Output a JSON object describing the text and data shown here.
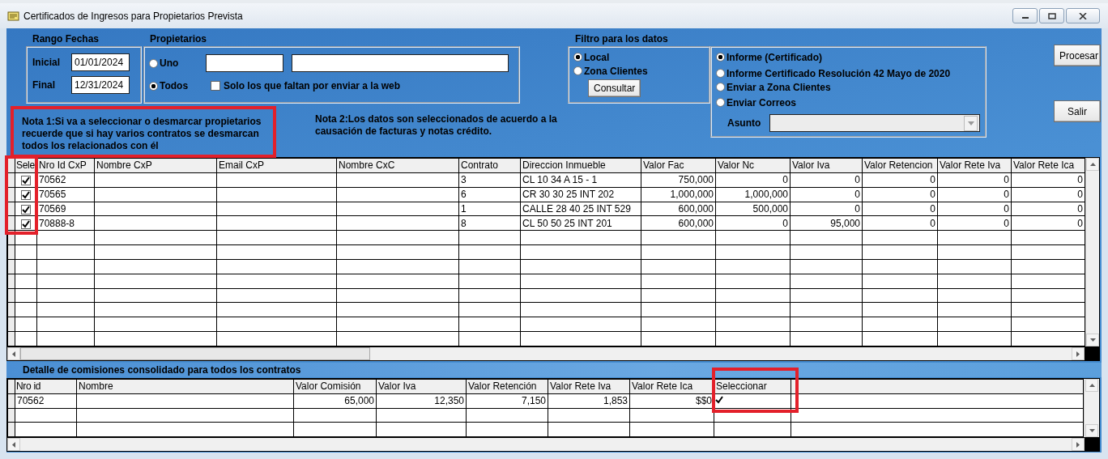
{
  "window": {
    "title": "Certificados de Ingresos para Propietarios Prevista"
  },
  "date_range": {
    "label": "Rango Fechas",
    "fields": [
      {
        "label": "Inicial",
        "value": "01/01/2024"
      },
      {
        "label": "Final",
        "value": "12/31/2024"
      }
    ]
  },
  "owners": {
    "label": "Propietarios",
    "options": [
      {
        "label": "Uno",
        "selected": false
      },
      {
        "label": "Todos",
        "selected": true
      }
    ],
    "pending_only": {
      "label": "Solo los que faltan  por enviar a la web",
      "checked": false
    }
  },
  "filter": {
    "label": "Filtro para los datos",
    "options": [
      {
        "label": "Local",
        "selected": true
      },
      {
        "label": "Zona Clientes",
        "selected": false
      }
    ],
    "button": "Consultar"
  },
  "output": {
    "options": [
      {
        "label": "Informe (Certificado)",
        "selected": true
      },
      {
        "label": "Informe Certificado Resolución 42 Mayo de 2020",
        "selected": false
      },
      {
        "label": "Enviar a Zona Clientes",
        "selected": false
      },
      {
        "label": "Enviar Correos",
        "selected": false
      }
    ],
    "subject": {
      "label": "Asunto",
      "disabled": true
    }
  },
  "buttons": [
    "Procesar",
    "Salir"
  ],
  "notes": [
    {
      "text": "Nota 1:Si va a seleccionar o desmarcar propietarios recuerde que si hay varios contratos se desmarcan todos los relacionados con él",
      "highlighted": true
    },
    {
      "text": "Nota 2:Los datos son seleccionados de acuerdo a la causación de facturas y notas crédito.",
      "highlighted": false
    }
  ],
  "main_table": {
    "columns": [
      {
        "label": "Sele",
        "kind": "check",
        "highlighted": true
      },
      {
        "label": "Nro Id CxP",
        "kind": "text",
        "highlighted": false
      },
      {
        "label": "Nombre CxP",
        "kind": "text",
        "highlighted": false
      },
      {
        "label": "Email CxP",
        "kind": "text",
        "highlighted": false
      },
      {
        "label": "Nombre CxC",
        "kind": "text",
        "highlighted": false
      },
      {
        "label": "Contrato",
        "kind": "text",
        "highlighted": false
      },
      {
        "label": "Direccion Inmueble",
        "kind": "text",
        "highlighted": false
      },
      {
        "label": "Valor Fac",
        "kind": "number",
        "highlighted": false
      },
      {
        "label": "Valor Nc",
        "kind": "number",
        "highlighted": false
      },
      {
        "label": "Valor Iva",
        "kind": "number",
        "highlighted": false
      },
      {
        "label": "Valor Retencion",
        "kind": "number",
        "highlighted": false
      },
      {
        "label": "Valor Rete Iva",
        "kind": "number",
        "highlighted": false
      },
      {
        "label": "Valor Rete Ica",
        "kind": "number",
        "highlighted": false
      }
    ],
    "rows": [
      {
        "checked": true,
        "cells": [
          "",
          "70562",
          "",
          "",
          "",
          "3",
          "CL 10 34 A 15 - 1",
          "750,000",
          "0",
          "0",
          "0",
          "0",
          "0"
        ]
      },
      {
        "checked": true,
        "cells": [
          "",
          "70565",
          "",
          "",
          "",
          "6",
          "CR 30 30 25 INT 202",
          "1,000,000",
          "1,000,000",
          "0",
          "0",
          "0",
          "0"
        ]
      },
      {
        "checked": true,
        "cells": [
          "",
          "70569",
          "",
          "",
          "",
          "1",
          "CALLE 28 40 25 INT 529",
          "600,000",
          "500,000",
          "0",
          "0",
          "0",
          "0"
        ]
      },
      {
        "checked": true,
        "cells": [
          "",
          "70888-8",
          "",
          "",
          "",
          "8",
          "CL 50 50 25 INT 201",
          "600,000",
          "0",
          "95,000",
          "0",
          "0",
          "0"
        ]
      }
    ]
  },
  "detail": {
    "title": "Detalle de comisiones consolidado para todos los contratos",
    "columns": [
      {
        "label": "Nro id",
        "kind": "text",
        "highlighted": false
      },
      {
        "label": "Nombre",
        "kind": "text",
        "highlighted": false
      },
      {
        "label": "Valor Comisión",
        "kind": "number",
        "highlighted": false
      },
      {
        "label": "Valor Iva",
        "kind": "number",
        "highlighted": false
      },
      {
        "label": "Valor Retención",
        "kind": "number",
        "highlighted": false
      },
      {
        "label": "Valor Rete Iva",
        "kind": "number",
        "highlighted": false
      },
      {
        "label": "Valor Rete Ica",
        "kind": "number",
        "highlighted": false
      },
      {
        "label": "Seleccionar",
        "kind": "check",
        "highlighted": true
      }
    ],
    "rows": [
      {
        "checked": true,
        "cells": [
          "70562",
          "",
          "65,000",
          "12,350",
          "7,150",
          "1,853",
          "$$0",
          ""
        ]
      }
    ]
  }
}
